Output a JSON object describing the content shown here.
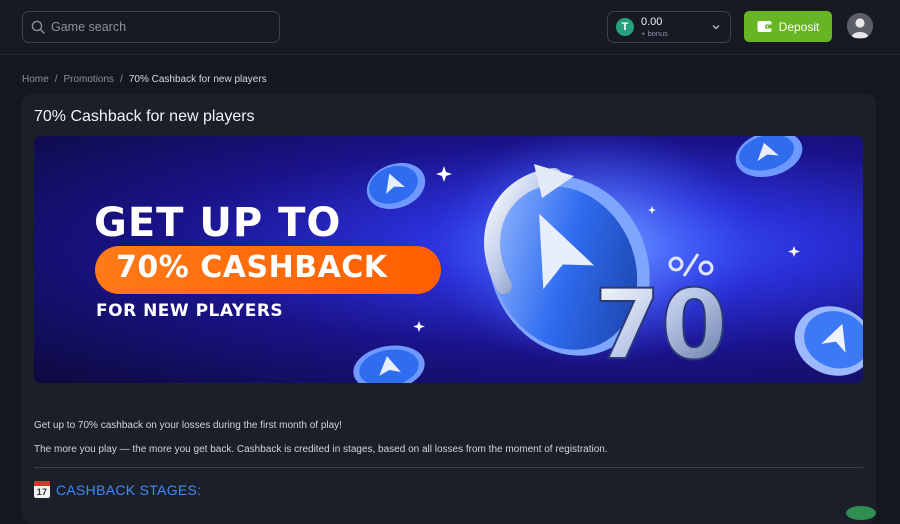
{
  "header": {
    "search": {
      "placeholder": "Game search"
    },
    "balance": {
      "amount": "0.00",
      "bonus_label": "+ bonus",
      "currency_symbol": "T"
    },
    "deposit_label": "Deposit"
  },
  "breadcrumb": {
    "items": [
      "Home",
      "Promotions"
    ],
    "current": "70% Cashback for new players",
    "separator": "/"
  },
  "page": {
    "title": "70% Cashback for new players",
    "banner": {
      "line1": "GET UP TO",
      "line2": "70% CASHBACK",
      "line3": "FOR NEW PLAYERS",
      "graphic_text": "70"
    },
    "description": [
      "Get up to 70% cashback on your losses during the first month of play!",
      "The more you play — the more you get back. Cashback is credited in stages, based on all losses from the moment of registration."
    ],
    "section_heading": "CASHBACK STAGES:",
    "section_icon": "calendar-icon",
    "calendar_day": "17"
  },
  "colors": {
    "background": "#14171f",
    "panel": "#1b1f29",
    "accent_green": "#67b424",
    "accent_blue": "#3d8bff",
    "accent_orange": "#ff6a00",
    "tether_green": "#26a17b"
  }
}
